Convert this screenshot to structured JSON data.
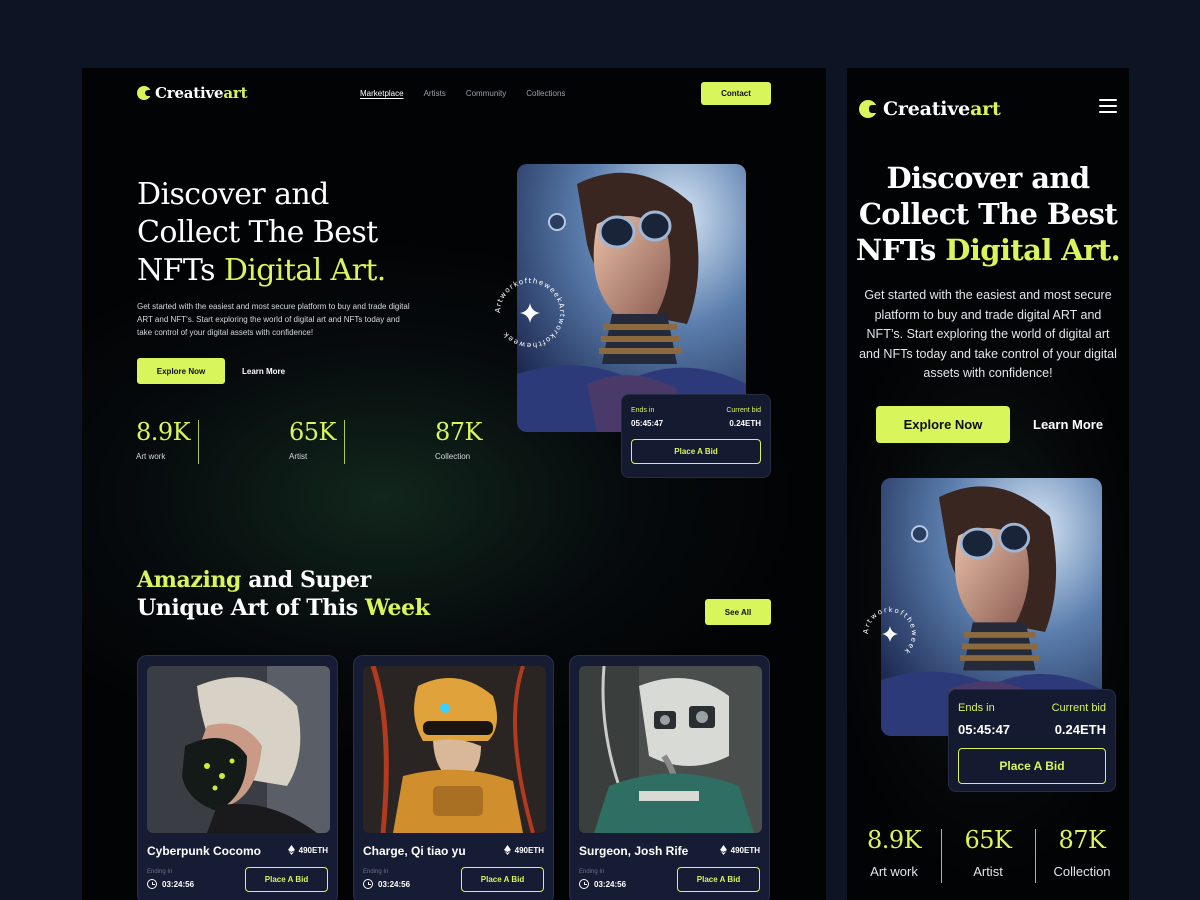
{
  "brand": {
    "name_main": "Creative",
    "name_accent": "art"
  },
  "nav": {
    "links": [
      "Marketplace",
      "Artists",
      "Community",
      "Collections"
    ],
    "contact_label": "Contact"
  },
  "hero": {
    "title_line1": "Discover and",
    "title_line2": "Collect The Best",
    "title_line3_plain": "NFTs ",
    "title_line3_accent": "Digital Art.",
    "description": "Get started with the easiest and most secure platform to buy and trade digital ART and NFT’s. Start exploring the world of digital art and NFTs today and take control of your digital assets with confidence!",
    "explore_label": "Explore Now",
    "learn_label": "Learn More",
    "badge_text": "Artworkoftheweek",
    "stats": [
      {
        "value": "8.9K",
        "label": "Art work"
      },
      {
        "value": "65K",
        "label": "Artist"
      },
      {
        "value": "87K",
        "label": "Collection"
      }
    ]
  },
  "bid": {
    "ends_label": "Ends in",
    "ends_value": "05:45:47",
    "current_label": "Current bid",
    "current_value": "0.24ETH",
    "button_label": "Place A Bid"
  },
  "weekly": {
    "title_accent1": "Amazing",
    "title_plain1": " and Super",
    "title_plain2": "Unique Art of This ",
    "title_accent2": "Week",
    "see_all_label": "See All",
    "cards": [
      {
        "name": "Cyberpunk Cocomo",
        "price": "490ETH",
        "ending_label": "Ending In",
        "time": "03:24:56",
        "bid_label": "Place A Bid"
      },
      {
        "name": "Charge, Qi tiao yu",
        "price": "490ETH",
        "ending_label": "Ending In",
        "time": "03:24:56",
        "bid_label": "Place A Bid"
      },
      {
        "name": "Surgeon, Josh Rife",
        "price": "490ETH",
        "ending_label": "Ending In",
        "time": "03:24:56",
        "bid_label": "Place A Bid"
      }
    ]
  },
  "colors": {
    "accent": "#d8f55b",
    "background": "#0d1424",
    "card": "#161c33"
  },
  "icons": [
    "logo-icon",
    "star-icon",
    "eth-icon",
    "clock-icon",
    "hamburger-icon"
  ]
}
